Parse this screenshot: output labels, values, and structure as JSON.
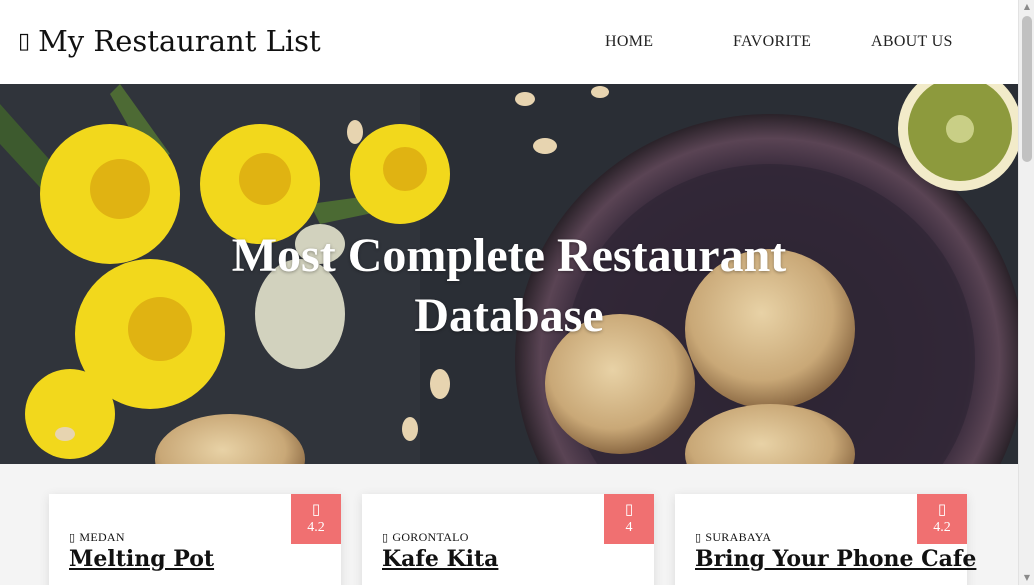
{
  "header": {
    "brand_icon": "▯",
    "brand_title": "My Restaurant List",
    "nav": [
      {
        "label": "HOME"
      },
      {
        "label": "FAVORITE"
      },
      {
        "label": "ABOUT US"
      }
    ]
  },
  "hero": {
    "title_line1": "Most Complete Restaurant",
    "title_line2": "Database"
  },
  "restaurants": [
    {
      "city": "MEDAN",
      "name": "Melting Pot",
      "rating": "4.2",
      "star_icon": "▯",
      "pin_icon": "▯"
    },
    {
      "city": "GORONTALO",
      "name": "Kafe Kita",
      "rating": "4",
      "star_icon": "▯",
      "pin_icon": "▯"
    },
    {
      "city": "SURABAYA",
      "name": "Bring Your Phone Cafe",
      "rating": "4.2",
      "star_icon": "▯",
      "pin_icon": "▯"
    }
  ],
  "colors": {
    "rating_badge": "#f07071",
    "header_bg": "#ffffff",
    "hero_bg": "#262a30"
  }
}
